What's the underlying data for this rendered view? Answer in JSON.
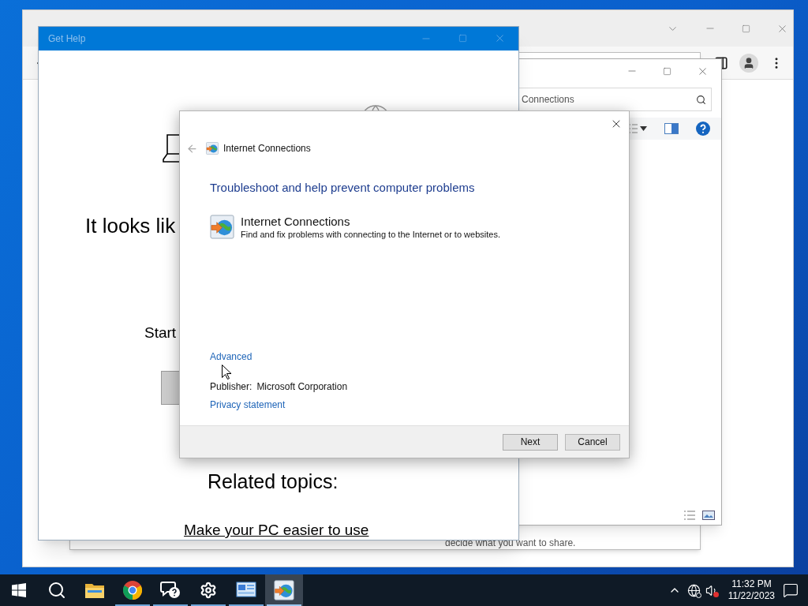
{
  "control_panel_window": {
    "footer_text": "decide what you want to share."
  },
  "explorer_window": {
    "search": {
      "value": "Connections"
    }
  },
  "get_help_window": {
    "title": "Get Help",
    "heading": "It looks lik",
    "prompt": "Start",
    "related_title": "Related topics:",
    "related_links": [
      "Make your PC easier to use"
    ]
  },
  "troubleshooter": {
    "breadcrumb": "Internet Connections",
    "heading": "Troubleshoot and help prevent computer problems",
    "item": {
      "title": "Internet Connections",
      "description": "Find and fix problems with connecting to the Internet or to websites."
    },
    "advanced_link": "Advanced",
    "publisher_label": "Publisher:",
    "publisher": "Microsoft Corporation",
    "privacy_link": "Privacy statement",
    "buttons": [
      {
        "label": "Next",
        "kind": "next"
      },
      {
        "label": "Cancel",
        "kind": "cancel"
      }
    ]
  },
  "taskbar": {
    "apps": [
      {
        "kind": "start",
        "running": false,
        "selected": false
      },
      {
        "kind": "search",
        "running": false,
        "selected": false
      },
      {
        "kind": "explorer",
        "running": false,
        "selected": false
      },
      {
        "kind": "browser",
        "running": true,
        "selected": false
      },
      {
        "kind": "help",
        "running": true,
        "selected": false
      },
      {
        "kind": "settings",
        "running": true,
        "selected": false
      },
      {
        "kind": "control-panel",
        "running": true,
        "selected": false
      },
      {
        "kind": "troubleshooter",
        "running": true,
        "selected": true
      }
    ],
    "volume_muted": true,
    "network_offline": true,
    "clock": {
      "time": "11:32 PM",
      "date": "11/22/2023"
    }
  }
}
